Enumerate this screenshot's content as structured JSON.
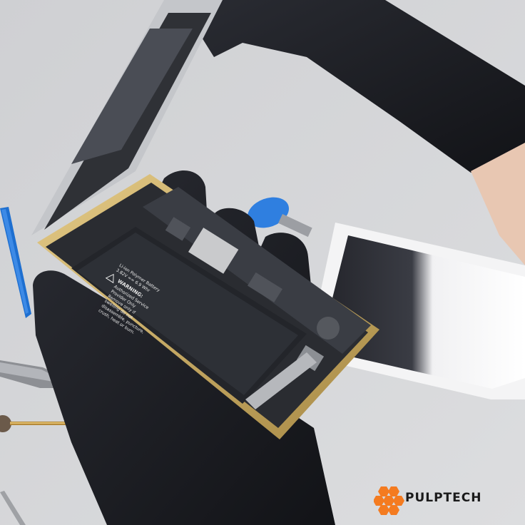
{
  "brand": {
    "name": "PULPTECH",
    "logo_color": "#f47b20",
    "text_color": "#1a1a1a"
  },
  "battery_label": {
    "line1": "Li-ion Polymer Battery",
    "line2": "3.82V == 6.9 Whr",
    "warning_title": "WARNING:",
    "warning_lines": [
      "Authorized Service",
      "Provider Only",
      "Remove only if",
      "swelling do not",
      "disassemble, puncture,",
      "crush, heat or burn."
    ]
  },
  "scene": {
    "background": "#d6d7d9",
    "phone_frame": "#c9a85c",
    "glove": "#1c1e24",
    "tool_blue": "#1e6fd0"
  }
}
